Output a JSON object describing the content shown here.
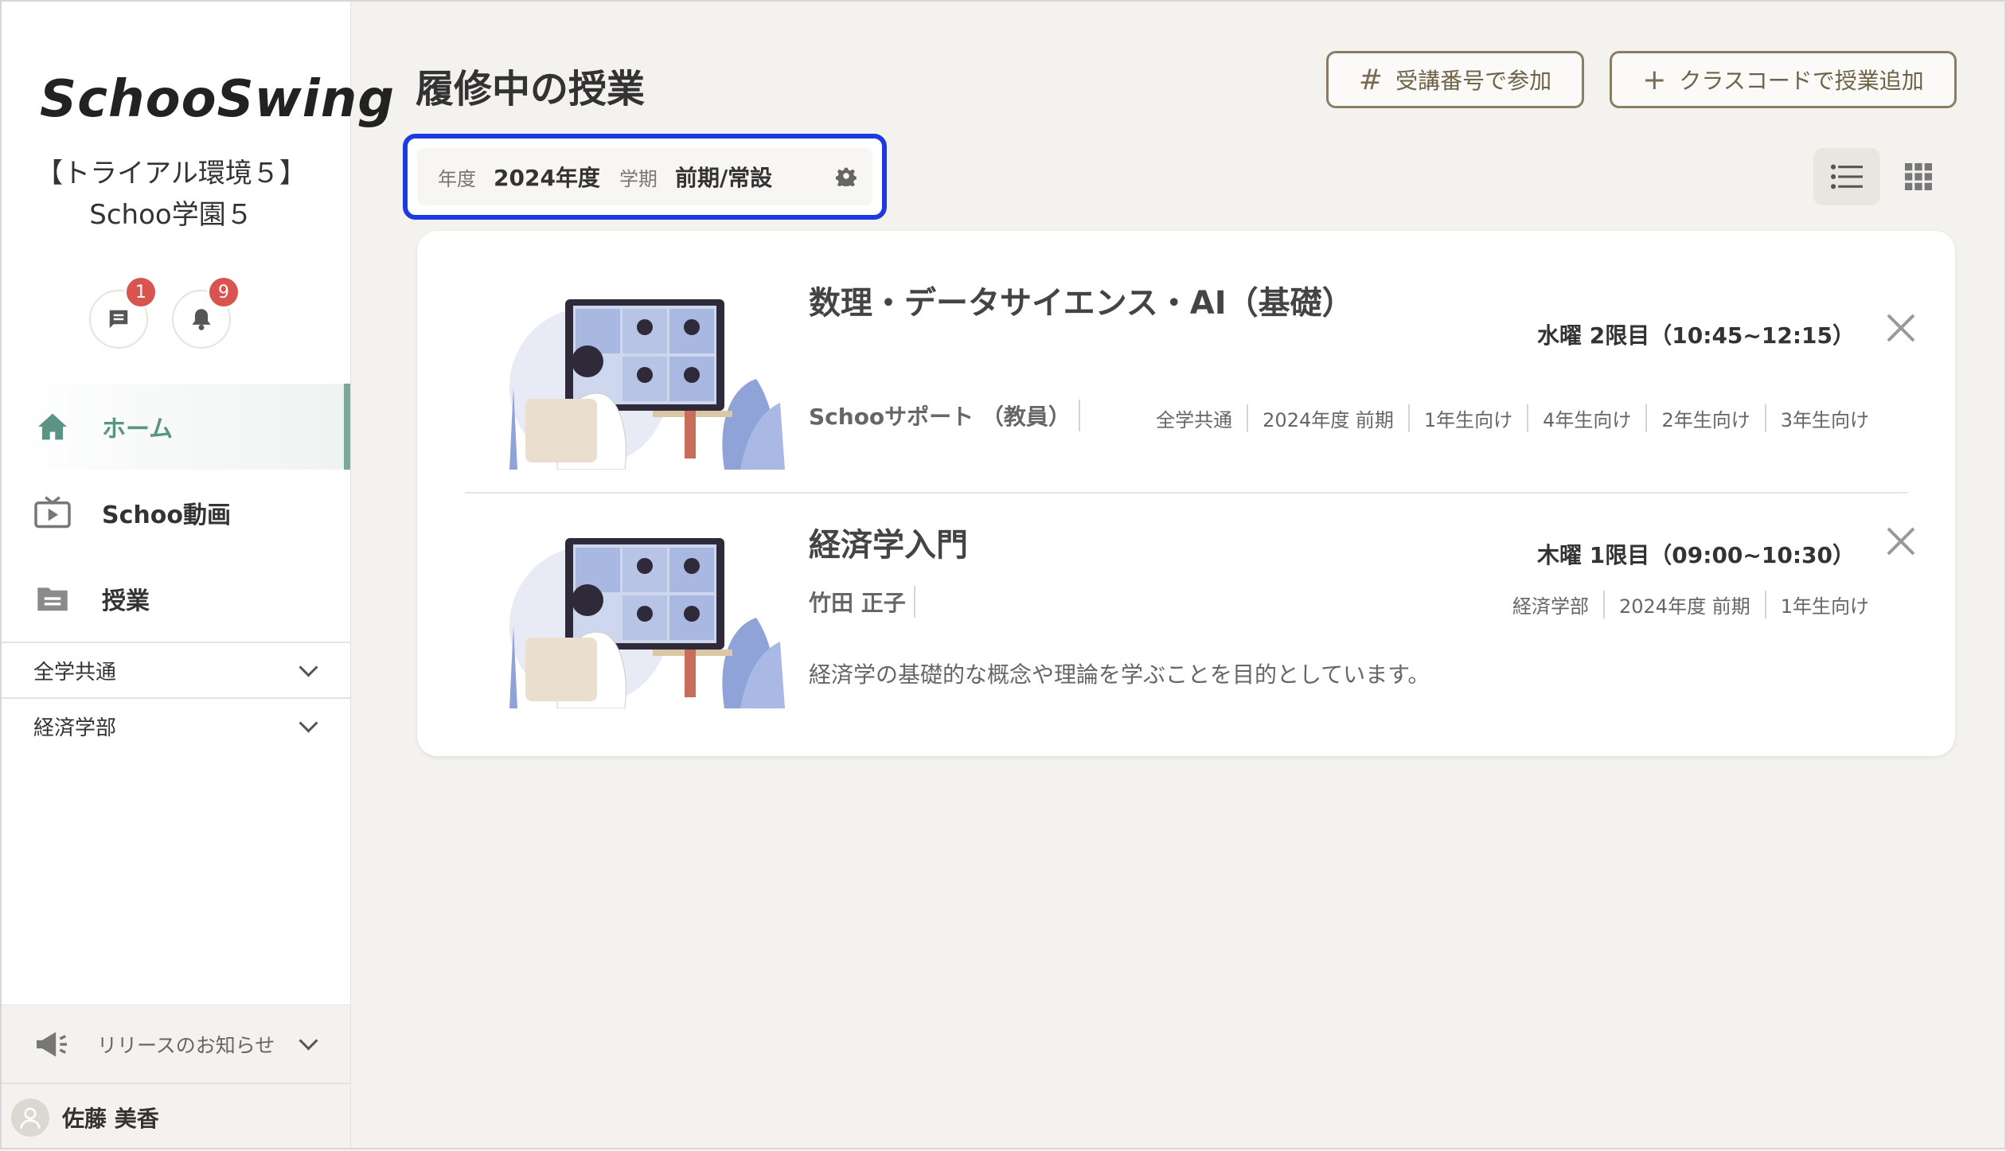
{
  "sidebar": {
    "logo": "SchooSwing",
    "org_name": "【トライアル環境５】Schoo学園５",
    "message_badge": "1",
    "notification_badge": "9",
    "nav": [
      {
        "label": "ホーム",
        "icon": "home-icon",
        "active": true
      },
      {
        "label": "Schoo動画",
        "icon": "tv-icon",
        "active": false
      },
      {
        "label": "授業",
        "icon": "folder-icon",
        "active": false
      }
    ],
    "groups": [
      {
        "label": "全学共通"
      },
      {
        "label": "経済学部"
      }
    ],
    "release_label": "リリースのお知らせ",
    "user_name": "佐藤 美香"
  },
  "main": {
    "title": "履修中の授業",
    "join_by_number_label": "受講番号で参加",
    "add_by_class_code_label": "クラスコードで授業追加",
    "filter": {
      "year_key": "年度",
      "year_value": "2024年度",
      "term_key": "学期",
      "term_value": "前期/常設"
    },
    "courses": [
      {
        "title": "数理・データサイエンス・AI（基礎）",
        "schedule": "水曜 2限目（10:45~12:15）",
        "teacher": "Schooサポート （教員）",
        "tags": [
          "全学共通",
          "2024年度 前期",
          "1年生向け",
          "4年生向け",
          "2年生向け",
          "3年生向け"
        ],
        "description": ""
      },
      {
        "title": "経済学入門",
        "schedule": "木曜 1限目（09:00~10:30）",
        "teacher": "竹田 正子",
        "tags": [
          "経済学部",
          "2024年度 前期",
          "1年生向け"
        ],
        "description": "経済学の基礎的な概念や理論を学ぶことを目的としています。"
      }
    ]
  },
  "colors": {
    "accent_green": "#5a9484",
    "button_brown": "#8a7d62",
    "highlight_blue": "#1b3be0",
    "badge_red": "#d9534f"
  }
}
